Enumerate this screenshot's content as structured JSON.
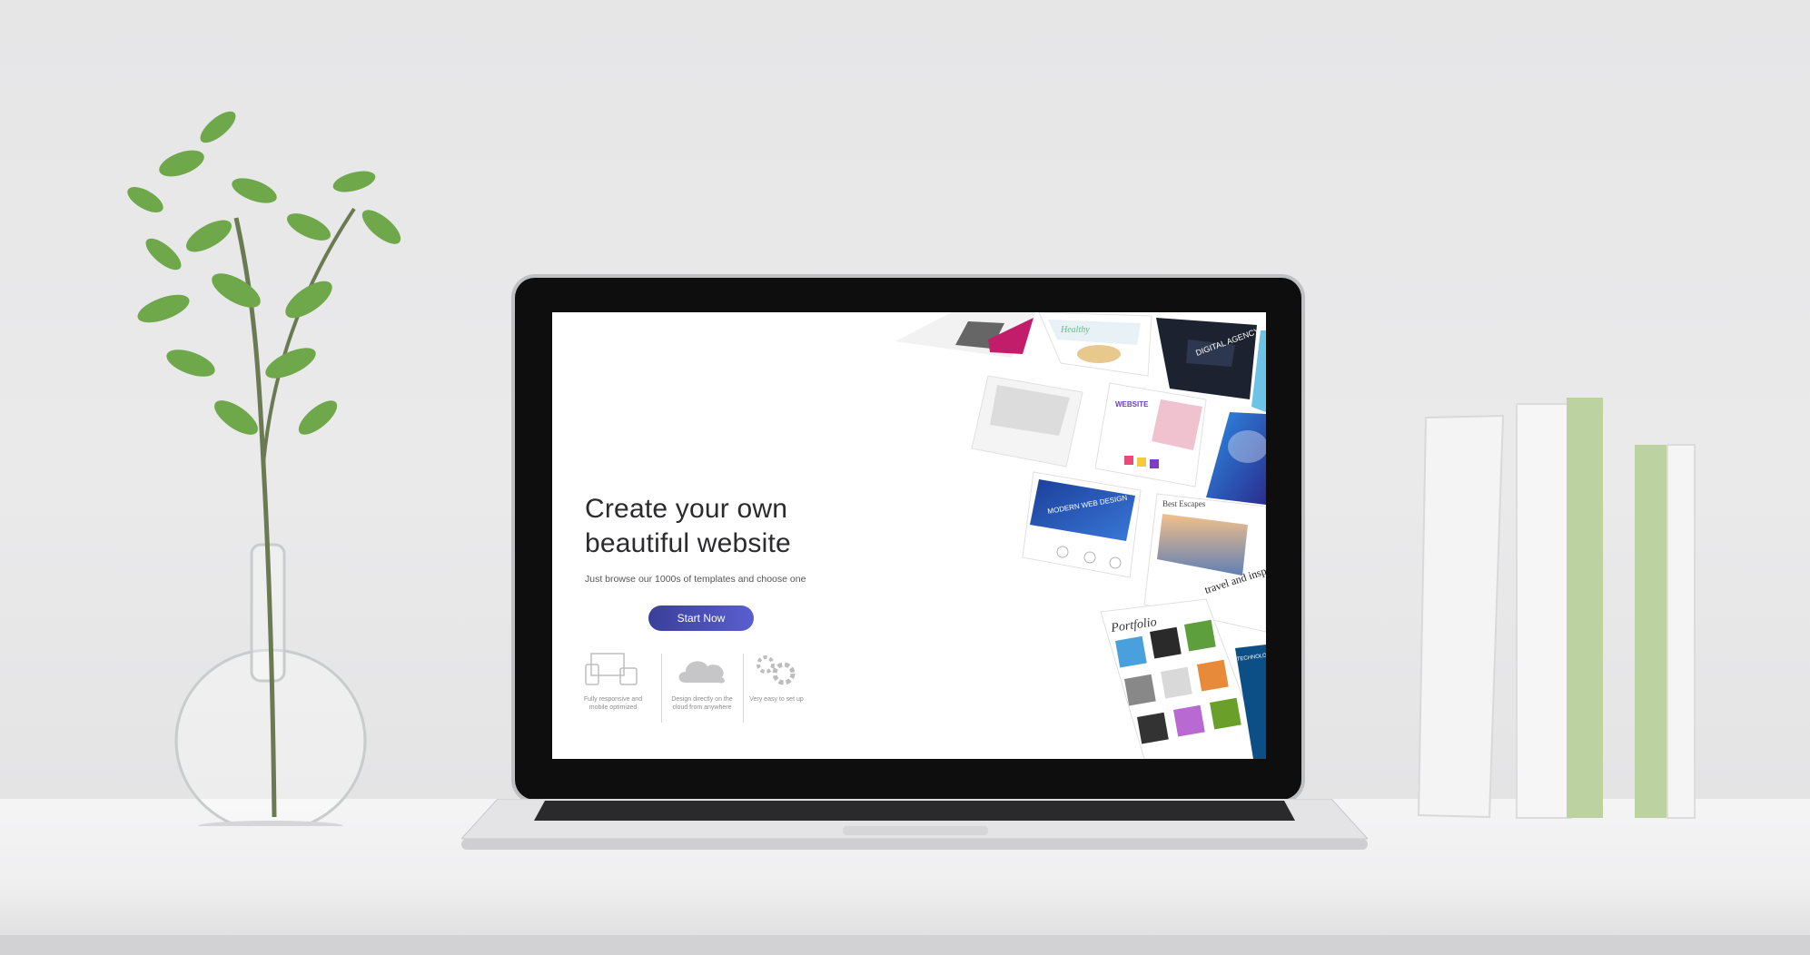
{
  "hero": {
    "title": "Create your own\nbeautiful website",
    "subtitle": "Just browse our 1000s of templates and choose one",
    "cta_label": "Start Now"
  },
  "features": [
    {
      "icon": "devices-icon",
      "label": "Fully responsive and mobile optimized"
    },
    {
      "icon": "cloud-icon",
      "label": "Design directly on the cloud from anywhere"
    },
    {
      "icon": "gears-icon",
      "label": "Very easy to set up"
    }
  ],
  "templates": {
    "modern": "MODERN WEB DESIGN",
    "digital": "DIGITAL AGENCY",
    "escapes": "Best Escapes",
    "travel": "travel and inspire your life",
    "portfolio": "Portfolio",
    "technology": "TECHNOLOGY INNOVATION",
    "website": "WEBSITE",
    "healthy": "Healthy"
  },
  "colors": {
    "accent": "#4a4fc0",
    "bg": "#ffffff"
  }
}
